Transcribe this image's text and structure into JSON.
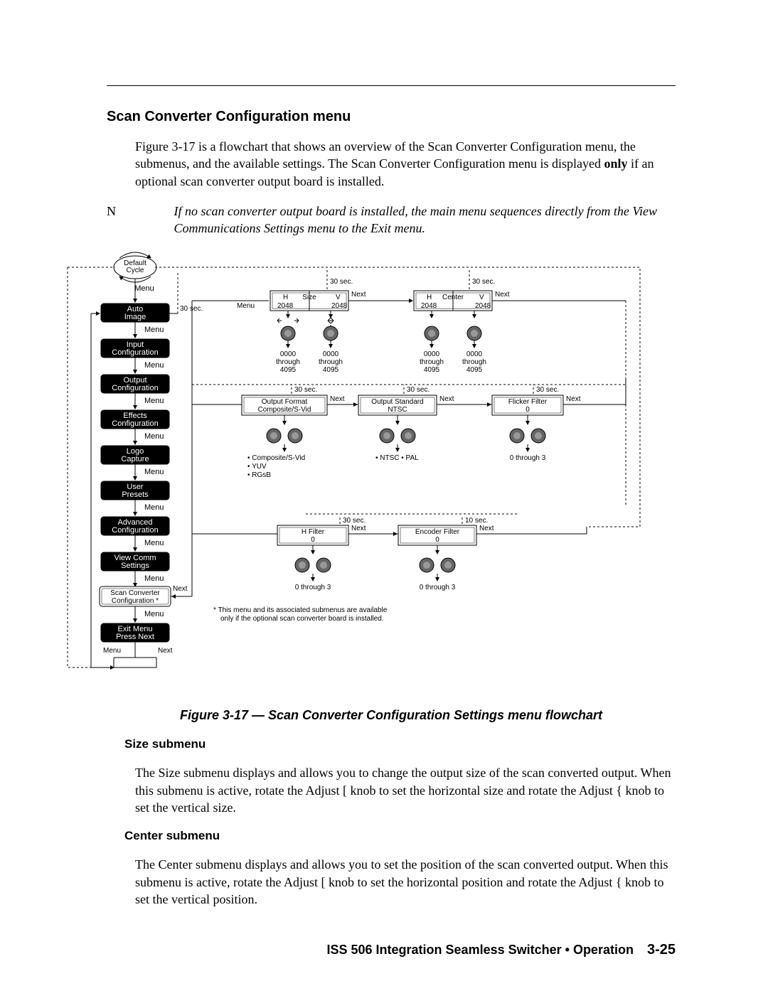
{
  "heading": "Scan Converter Configuration menu",
  "intro": "Figure 3-17 is a flowchart that shows an overview of the Scan Converter Configuration menu, the submenus, and the available settings.  The Scan Converter Configuration menu is displayed ",
  "intro_only": "only",
  "intro_tail": " if an optional scan converter output board is installed.",
  "note_label": "N",
  "note_text": "If no scan converter output board is installed, the main menu sequences directly from the View Communications Settings menu to the Exit menu.",
  "caption": "Figure 3-17 — Scan Converter Configuration Settings menu flowchart",
  "size_head": "Size submenu",
  "size_body": "The Size submenu displays and allows you to change the output size of the scan converted output.  When this submenu is active, rotate the Adjust [ knob to set the horizontal size and rotate the Adjust { knob to set the vertical size.",
  "center_head": "Center submenu",
  "center_body": "The Center submenu displays and allows you to set the position of the scan converted output.  When this submenu is active, rotate the Adjust [ knob to set the horizontal position and rotate the Adjust { knob to set the vertical position.",
  "footer_text": "ISS 506 Integration Seamless Switcher • Operation",
  "footer_page": "3-25",
  "flowchart": {
    "default_cycle": "Default Cycle",
    "menu_label": "Menu",
    "next_label": "Next",
    "main_menu": [
      "Auto Image",
      "Input Configuration",
      "Output Configuration",
      "Effects Configuration",
      "Logo Capture",
      "User Presets",
      "Advanced Configuration",
      "View Comm Settings",
      "Scan Converter Configuration *",
      "Exit Menu Press Next"
    ],
    "thirty_sec": "30 sec.",
    "ten_sec": "10 sec.",
    "size_box": {
      "title": "Size",
      "left_h": "H",
      "right_v": "V",
      "left_v": "2048",
      "right_val": "2048"
    },
    "center_box": {
      "title": "Center",
      "left_h": "H",
      "right_v": "V",
      "left_v": "2048",
      "right_val": "2048"
    },
    "range_line1": "0000",
    "range_line2": "through",
    "range_line3": "4095",
    "output_format": {
      "t1": "Output Format",
      "t2": "Composite/S-Vid"
    },
    "output_standard": {
      "t1": "Output Standard",
      "t2": "NTSC"
    },
    "flicker_filter": {
      "t1": "Flicker Filter",
      "t2": "0"
    },
    "h_filter": {
      "t1": "H Filter",
      "t2": "0"
    },
    "encoder_filter": {
      "t1": "Encoder Filter",
      "t2": "0"
    },
    "fmt_options": [
      "• Composite/S-Vid",
      "• YUV",
      "• RGsB"
    ],
    "std_options": "• NTSC   • PAL",
    "zero_three": "0 through 3",
    "footnote": "*  This menu and its associated submenus are available only if the optional scan converter board is installed."
  }
}
